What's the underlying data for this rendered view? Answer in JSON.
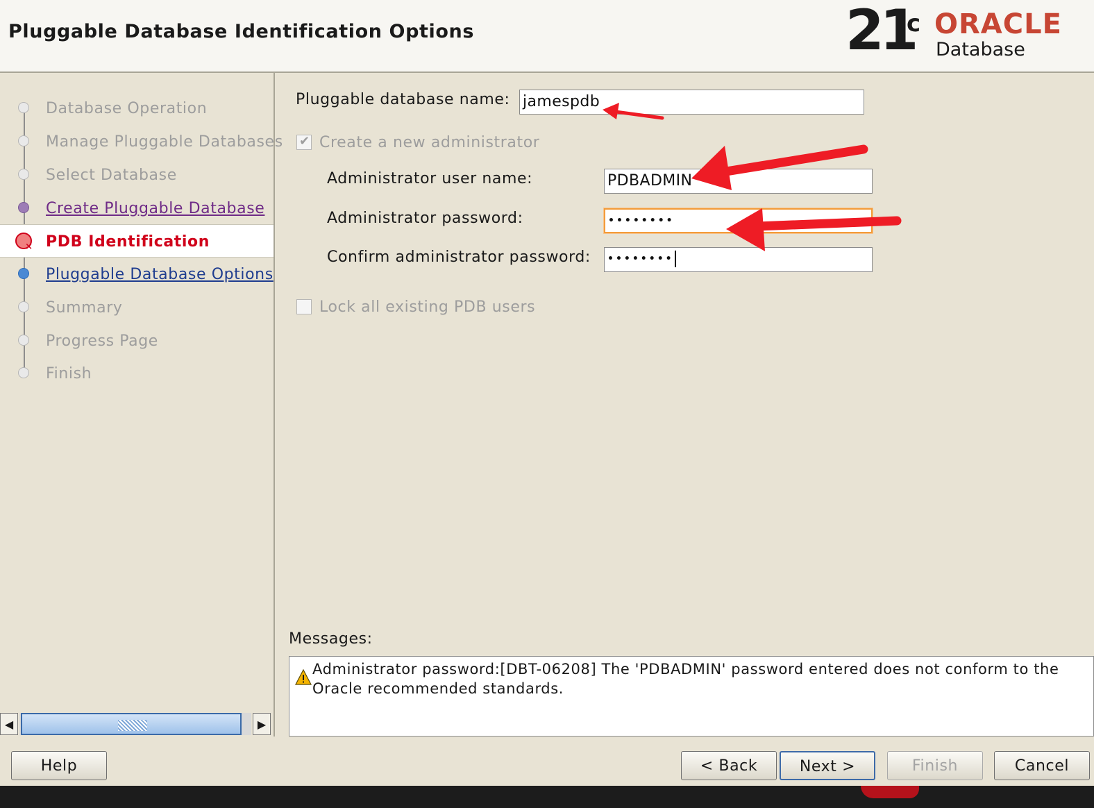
{
  "header": {
    "title": "Pluggable Database Identification Options",
    "logo": {
      "version": "21",
      "version_sup": "c",
      "brand": "ORACLE",
      "product": "Database"
    }
  },
  "sidebar": {
    "steps": [
      {
        "label": "Database Operation",
        "state": "done"
      },
      {
        "label": "Manage Pluggable Databases",
        "state": "done"
      },
      {
        "label": "Select Database",
        "state": "done"
      },
      {
        "label": "Create Pluggable Database",
        "state": "visited-link"
      },
      {
        "label": "PDB Identification",
        "state": "current"
      },
      {
        "label": "Pluggable Database Options",
        "state": "next-link"
      },
      {
        "label": "Summary",
        "state": "pending"
      },
      {
        "label": "Progress Page",
        "state": "pending"
      },
      {
        "label": "Finish",
        "state": "pending"
      }
    ]
  },
  "form": {
    "pdb_name_label": "Pluggable database name:",
    "pdb_name_value": "jamespdb",
    "create_admin_label": "Create a new administrator",
    "create_admin_checked": true,
    "admin_user_label": "Administrator user name:",
    "admin_user_value": "PDBADMIN",
    "admin_password_label": "Administrator password:",
    "admin_password_mask": "••••••••",
    "confirm_password_label": "Confirm administrator password:",
    "confirm_password_mask": "••••••••",
    "lock_users_label": "Lock all existing PDB users",
    "lock_users_checked": false
  },
  "messages": {
    "label": "Messages:",
    "text": "Administrator password:[DBT-06208] The 'PDBADMIN' password entered does not conform to the Oracle recommended standards.",
    "icon": "warning-icon"
  },
  "buttons": {
    "help": "Help",
    "back": "< Back",
    "next": "Next >",
    "finish": "Finish",
    "cancel": "Cancel"
  },
  "colors": {
    "accent_current_step": "#d0021b",
    "annotation_arrow": "#ee1c25",
    "focus_border": "#f39c3a",
    "oracle_red": "#c74634"
  }
}
